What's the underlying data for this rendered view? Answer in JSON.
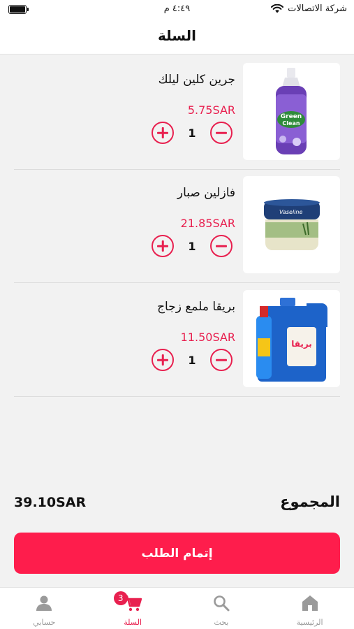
{
  "status_bar": {
    "carrier": "شركة الاتصالات",
    "time": "٤:٤٩ م"
  },
  "header": {
    "title": "السلة"
  },
  "cart": {
    "items": [
      {
        "name": "جرين كلين ليلك",
        "price": "5.75SAR",
        "quantity": "1",
        "image": "dish-soap-bottle-purple"
      },
      {
        "name": "فازلين صبار",
        "price": "21.85SAR",
        "quantity": "1",
        "image": "vaseline-jar-aloe"
      },
      {
        "name": "بريقا ملمع زجاج",
        "price": "11.50SAR",
        "quantity": "1",
        "image": "glass-cleaner-jerrycan-blue"
      }
    ]
  },
  "summary": {
    "total_label": "المجموع",
    "total_value": "39.10SAR"
  },
  "checkout": {
    "label": "إتمام الطلب"
  },
  "tabs": [
    {
      "label": "حسابي",
      "icon": "person-icon"
    },
    {
      "label": "السلة",
      "icon": "cart-icon",
      "badge": "3",
      "active": true
    },
    {
      "label": "بحث",
      "icon": "search-icon"
    },
    {
      "label": "الرئيسية",
      "icon": "home-icon"
    }
  ],
  "colors": {
    "accent": "#e8204f",
    "button": "#fe1d4c",
    "inactive": "#9a9a9a"
  }
}
